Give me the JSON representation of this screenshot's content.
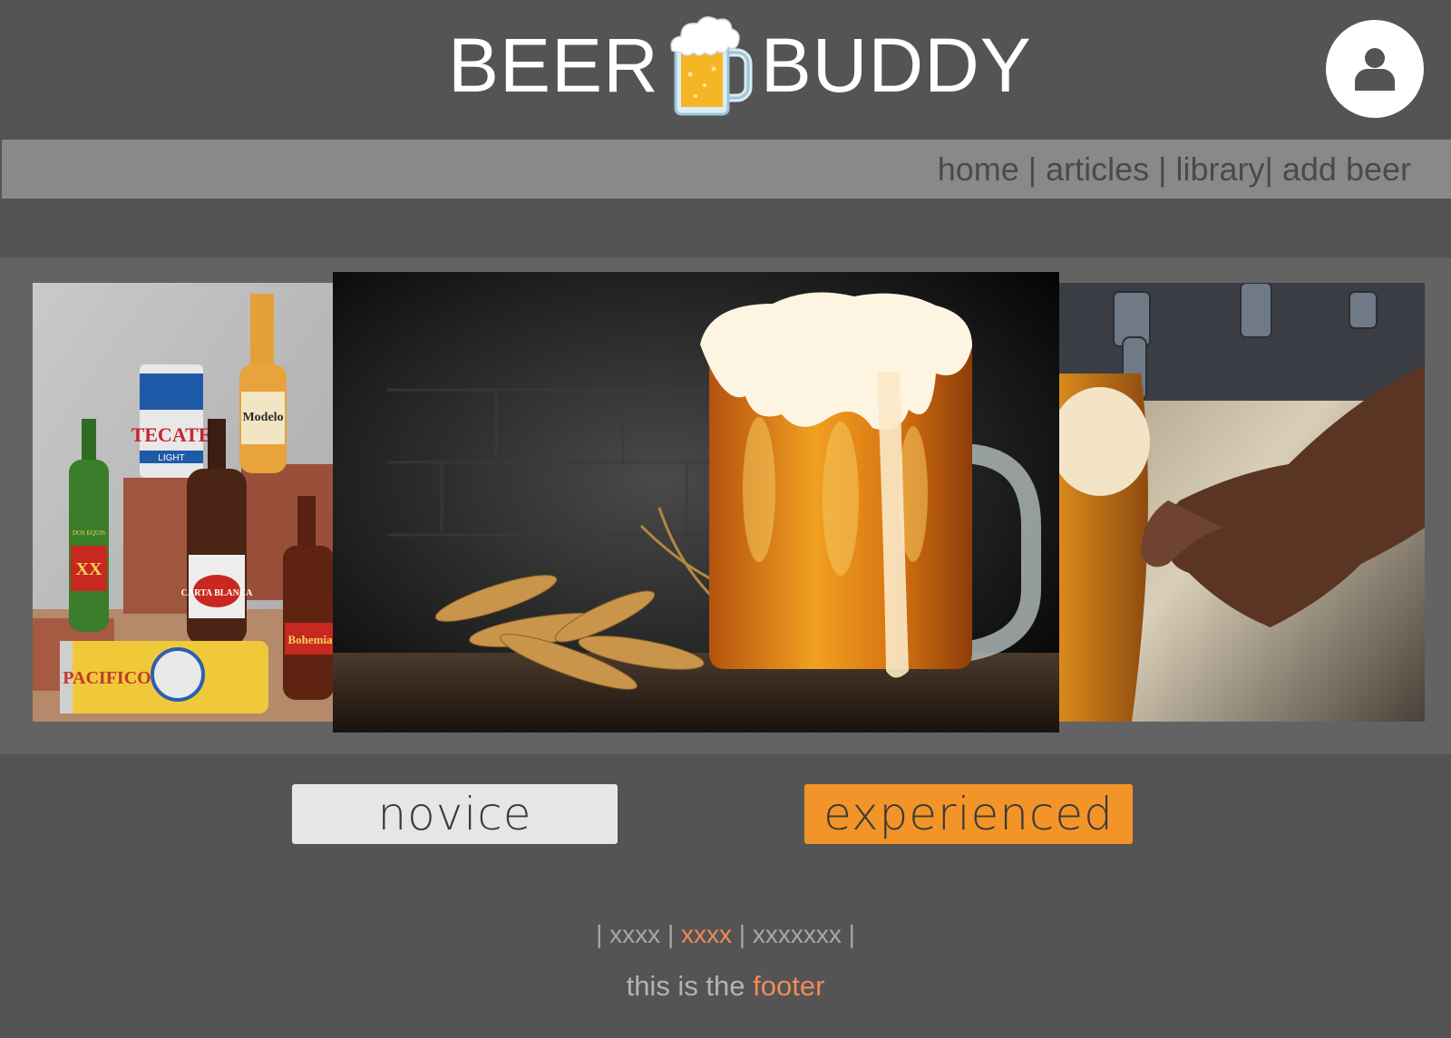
{
  "header": {
    "logo_left": "BEER",
    "logo_right": "BUDDY",
    "logo_icon": "beer-mug-icon",
    "profile_icon": "user-icon"
  },
  "nav": {
    "items": [
      {
        "label": "home"
      },
      {
        "label": "articles"
      },
      {
        "label": "library"
      },
      {
        "label": "add beer"
      }
    ],
    "separators": [
      " | ",
      " | ",
      "| "
    ]
  },
  "carousel": {
    "slides": [
      {
        "subject": "assorted bottles and cans of beer on bricks",
        "labels": [
          "TECATE",
          "LIGHT",
          "Modelo",
          "XX",
          "DOS EQUIS",
          "CARTA BLANCA",
          "Bohemia",
          "PACIFICO"
        ]
      },
      {
        "subject": "foaming mug of beer beside wheat sheaves"
      },
      {
        "subject": "hand pouring beer from a tap"
      }
    ]
  },
  "buttons": {
    "novice": "novice",
    "experienced": "experienced"
  },
  "footer": {
    "links": [
      {
        "label": "xxxx",
        "active": false
      },
      {
        "label": "xxxx",
        "active": true
      },
      {
        "label": "xxxxxxx",
        "active": false
      }
    ],
    "pipe": "|",
    "text_prefix": "this is the ",
    "text_accent": "footer"
  },
  "colors": {
    "background": "#545454",
    "nav_bar": "#898989",
    "carousel_band": "#636363",
    "accent_orange": "#f29427",
    "footer_accent": "#f08a5a",
    "novice_button": "#e6e6e6"
  }
}
